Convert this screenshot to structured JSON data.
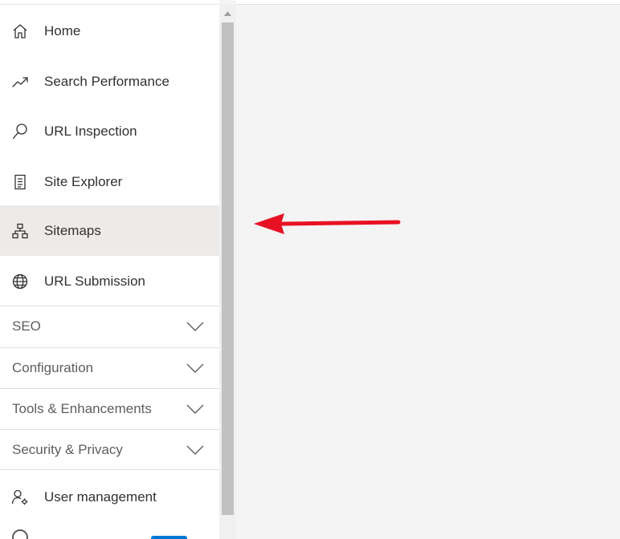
{
  "nav": {
    "items": [
      {
        "label": "Home",
        "icon": "home-icon"
      },
      {
        "label": "Search Performance",
        "icon": "trend-icon"
      },
      {
        "label": "URL Inspection",
        "icon": "search-icon"
      },
      {
        "label": "Site Explorer",
        "icon": "document-icon"
      },
      {
        "label": "Sitemaps",
        "icon": "sitemap-icon",
        "selected": true
      },
      {
        "label": "URL Submission",
        "icon": "globe-icon"
      }
    ],
    "groups": [
      {
        "label": "SEO"
      },
      {
        "label": "Configuration"
      },
      {
        "label": "Tools & Enhancements"
      },
      {
        "label": "Security & Privacy"
      }
    ],
    "user_management": {
      "label": "User management",
      "icon": "user-settings-icon"
    }
  },
  "colors": {
    "selected_bg": "#edebe9",
    "arrow": "#e81123",
    "text": "#323130"
  }
}
